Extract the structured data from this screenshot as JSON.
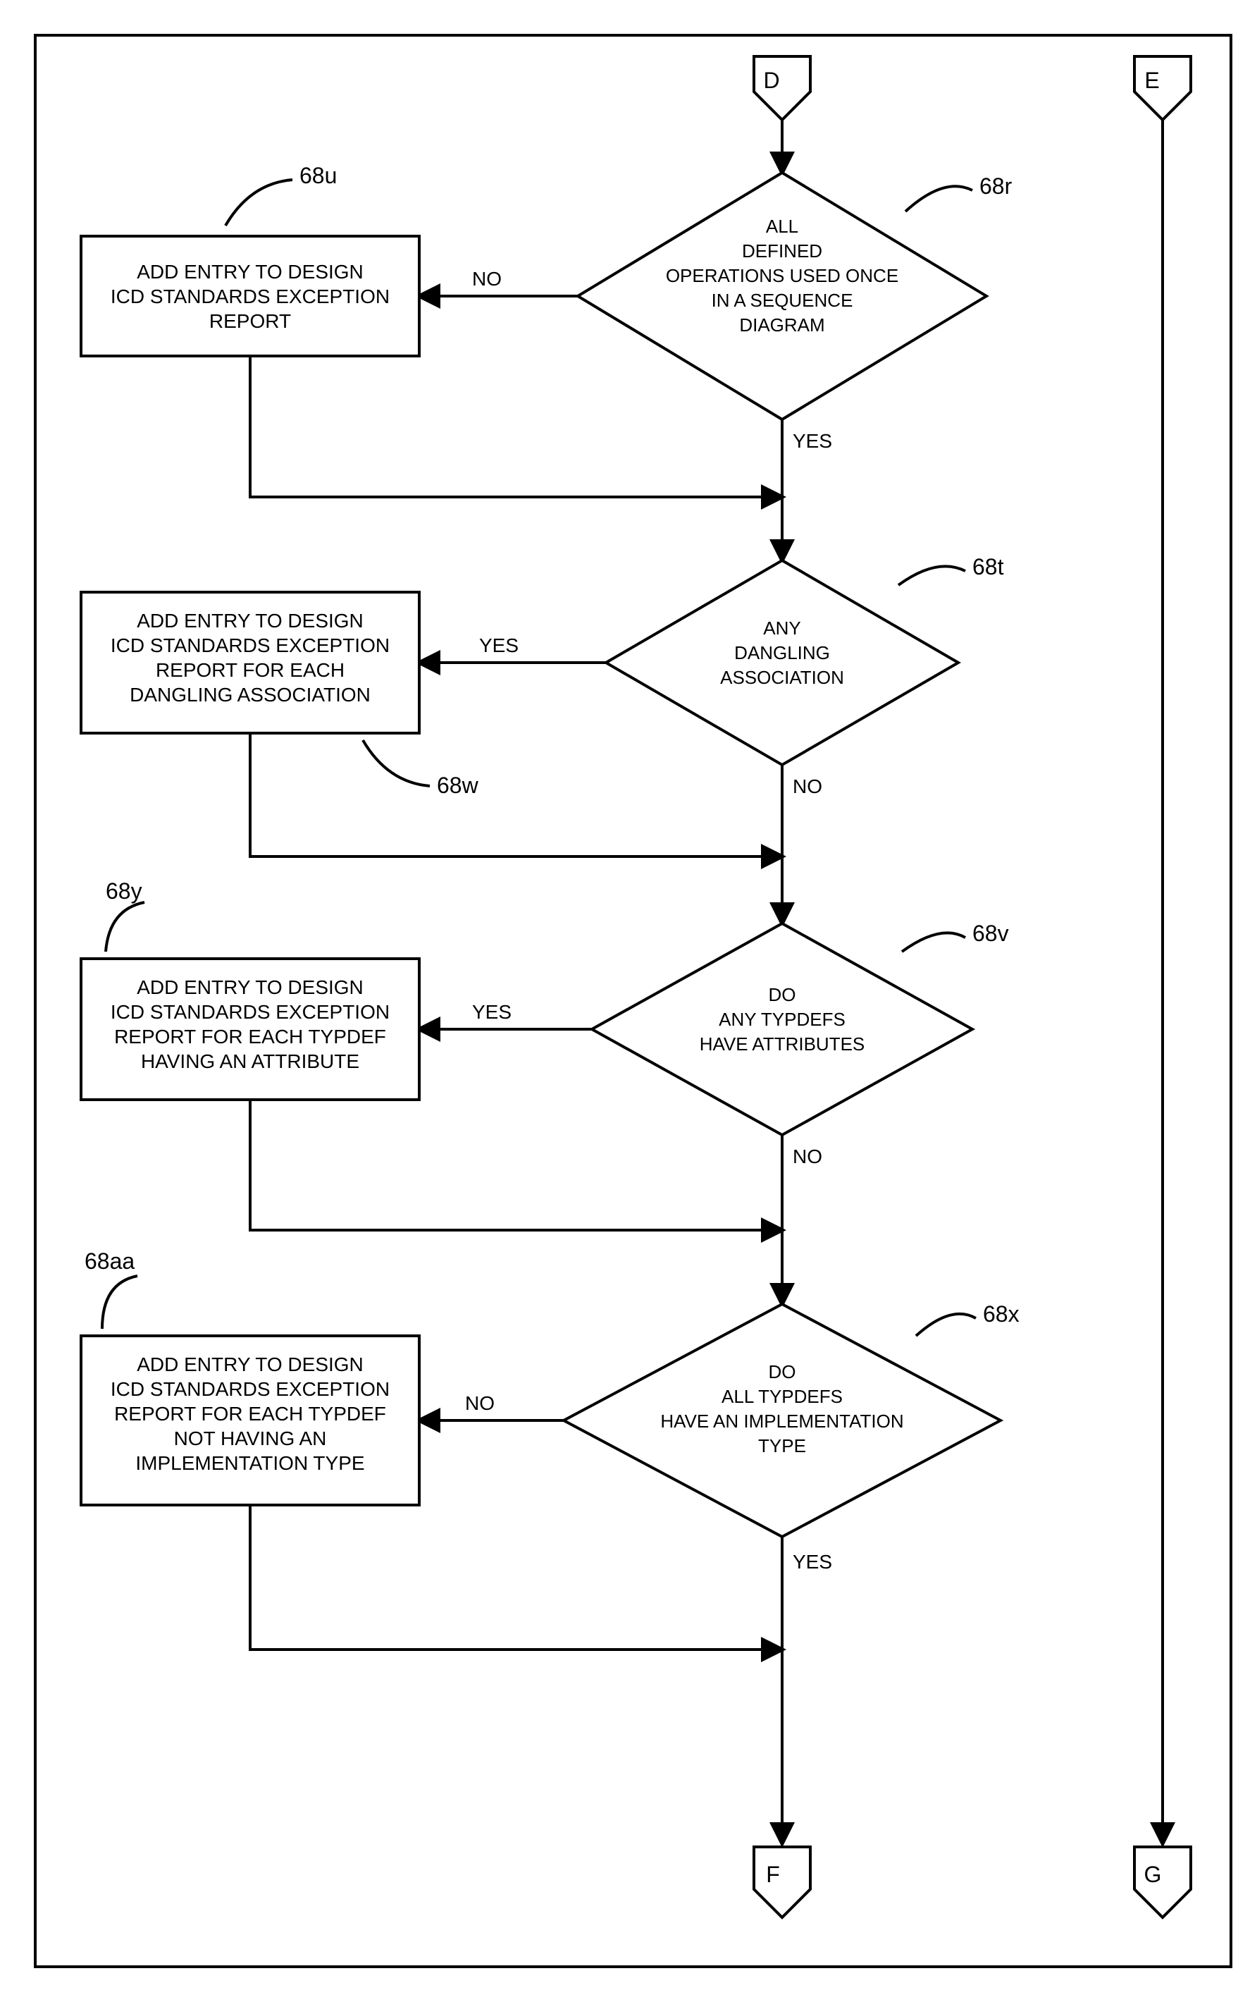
{
  "connectors": {
    "D": "D",
    "E": "E",
    "F": "F",
    "G": "G"
  },
  "decisions": {
    "r68r": {
      "label": "68r",
      "lines": [
        "ALL",
        "DEFINED",
        "OPERATIONS USED ONCE",
        "IN A SEQUENCE",
        "DIAGRAM"
      ],
      "no": "NO",
      "yes": "YES"
    },
    "r68t": {
      "label": "68t",
      "lines": [
        "ANY",
        "DANGLING",
        "ASSOCIATION"
      ],
      "no": "NO",
      "yes": "YES"
    },
    "r68v": {
      "label": "68v",
      "lines": [
        "DO",
        "ANY TYPDEFS",
        "HAVE ATTRIBUTES"
      ],
      "no": "NO",
      "yes": "YES"
    },
    "r68x": {
      "label": "68x",
      "lines": [
        "DO",
        "ALL TYPDEFS",
        "HAVE AN IMPLEMENTATION",
        "TYPE"
      ],
      "no": "NO",
      "yes": "YES"
    }
  },
  "processes": {
    "r68u": {
      "label": "68u",
      "lines": [
        "ADD ENTRY TO DESIGN",
        "ICD STANDARDS EXCEPTION",
        "REPORT"
      ]
    },
    "r68w": {
      "label": "68w",
      "lines": [
        "ADD ENTRY TO DESIGN",
        "ICD STANDARDS EXCEPTION",
        "REPORT FOR EACH",
        "DANGLING ASSOCIATION"
      ]
    },
    "r68y": {
      "label": "68y",
      "lines": [
        "ADD ENTRY TO DESIGN",
        "ICD STANDARDS EXCEPTION",
        "REPORT FOR EACH TYPDEF",
        "HAVING AN ATTRIBUTE"
      ]
    },
    "r68aa": {
      "label": "68aa",
      "lines": [
        "ADD ENTRY TO DESIGN",
        "ICD STANDARDS EXCEPTION",
        "REPORT FOR EACH TYPDEF",
        "NOT HAVING AN",
        "IMPLEMENTATION TYPE"
      ]
    }
  }
}
